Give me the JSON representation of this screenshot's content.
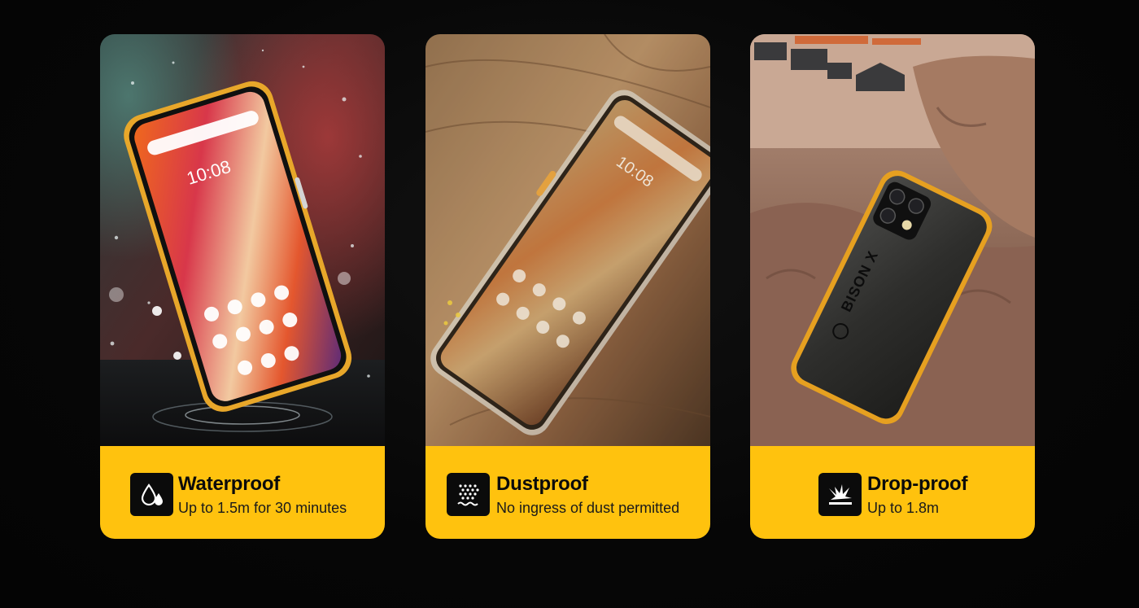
{
  "cards": [
    {
      "title": "Waterproof",
      "subtitle": "Up to 1.5m for 30 minutes",
      "icon": "water-drops-icon"
    },
    {
      "title": "Dustproof",
      "subtitle": "No ingress of dust permitted",
      "icon": "dust-particles-icon"
    },
    {
      "title": "Drop-proof",
      "subtitle": "Up to 1.8m",
      "icon": "impact-burst-icon"
    }
  ],
  "phone": {
    "clock": "10:08",
    "brand": "BISON X"
  },
  "colors": {
    "accent_yellow": "#ffc20e",
    "badge_black": "#0b0b0b",
    "background": "#050505"
  }
}
